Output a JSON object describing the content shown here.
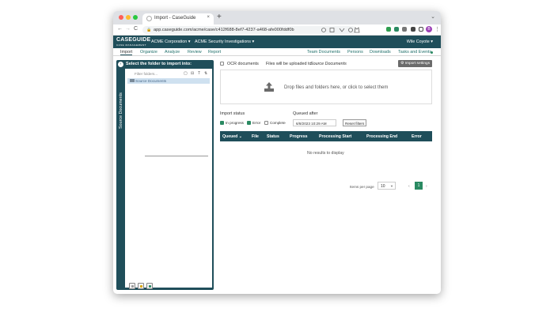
{
  "browser": {
    "tab_title": "Import - CaseGuide",
    "tab_close": "×",
    "new_tab": "+",
    "tab_menu": "⌄",
    "url": "app.caseguide.com/acme/case/c412f688-8ef7-4237-a468-afe000fddf0b",
    "nav_back": "←",
    "nav_forward": "→",
    "nav_reload": "C",
    "lock": "🔒",
    "profile_initial": "B",
    "colors": {
      "close_dot": "#ff5f57",
      "min_dot": "#febc2e",
      "max_dot": "#28c840"
    }
  },
  "app": {
    "logo": "CASEGUIDE",
    "logo_sub": "CASE MANAGEMENT",
    "org_dropdown": "ACME Corporation ▾",
    "case_dropdown": "ACME Security Investigations ▾",
    "user_dropdown": "Wile Coyote ▾",
    "colors": {
      "header": "#1f4e5a",
      "accent": "#2a8a62"
    }
  },
  "subnav": {
    "left": [
      "Import",
      "Organize",
      "Analyze",
      "Review",
      "Report"
    ],
    "right": [
      "Team Documents",
      "Persons",
      "Downloads",
      "Tasks and Events"
    ],
    "active": "Import"
  },
  "sidebar": {
    "vertical_label": "Source Documents",
    "title": "Select the folder to import into:",
    "filter_placeholder": "Filter folders...",
    "tree_items": [
      {
        "label": "Source Documents",
        "selected": true
      }
    ],
    "toolbar_icons": [
      "new-folder-icon",
      "collapse-icon",
      "text-icon",
      "sort-icon"
    ]
  },
  "main": {
    "ocr_label": "OCR documents",
    "upload_dest_prefix": "Files will be uploaded to:",
    "upload_dest": "Source Documents",
    "import_settings": "⚙ Import settings",
    "drop_text": "Drop files and folders here, or click to select them",
    "import_status_label": "Import status",
    "status_filters": [
      {
        "label": "In progress",
        "checked": true
      },
      {
        "label": "Error",
        "checked": true
      },
      {
        "label": "Complete",
        "checked": false
      }
    ],
    "queued_after_label": "Queued after",
    "queued_after_value": "6/8/2023 10:29 AM",
    "reset_filters": "Reset filters",
    "table_columns": [
      "Queued ⌄",
      "File",
      "Status",
      "Progress",
      "Processing Start",
      "Processing End",
      "Error"
    ],
    "empty_message": "No results to display",
    "items_per_page_label": "Items per page",
    "items_per_page": "10",
    "page_prev": "‹",
    "page_current": "1",
    "page_next": "›"
  }
}
